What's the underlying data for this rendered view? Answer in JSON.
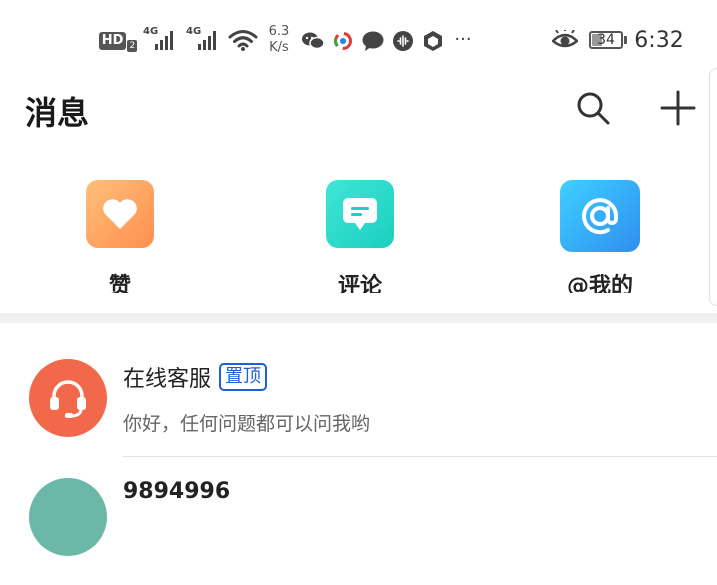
{
  "status_bar": {
    "hd_label": "HD",
    "hd_sub": "2",
    "sim1_label": "4G",
    "sim2_label": "4G",
    "net_speed_value": "6.3",
    "net_speed_unit": "K/s",
    "more_dots": "···",
    "battery": "34",
    "time": "6:32"
  },
  "header": {
    "title": "消息"
  },
  "quick_entries": [
    {
      "label": "赞",
      "icon": "heart-icon",
      "color": "#ff9f5e"
    },
    {
      "label": "评论",
      "icon": "comment-icon",
      "color": "#2fd9c9"
    },
    {
      "label": "@我的",
      "icon": "at-icon",
      "color": "#36aaf5"
    }
  ],
  "messages": [
    {
      "name": "在线客服",
      "tag": "置顶",
      "preview": "你好，任何问题都可以问我哟",
      "avatar": "headset-icon"
    },
    {
      "name": "9894996",
      "avatar": "user-avatar"
    }
  ],
  "colors": {
    "accent_blue": "#1e5fd6",
    "service_avatar": "#f2684a",
    "divider": "#f1f1f1"
  }
}
